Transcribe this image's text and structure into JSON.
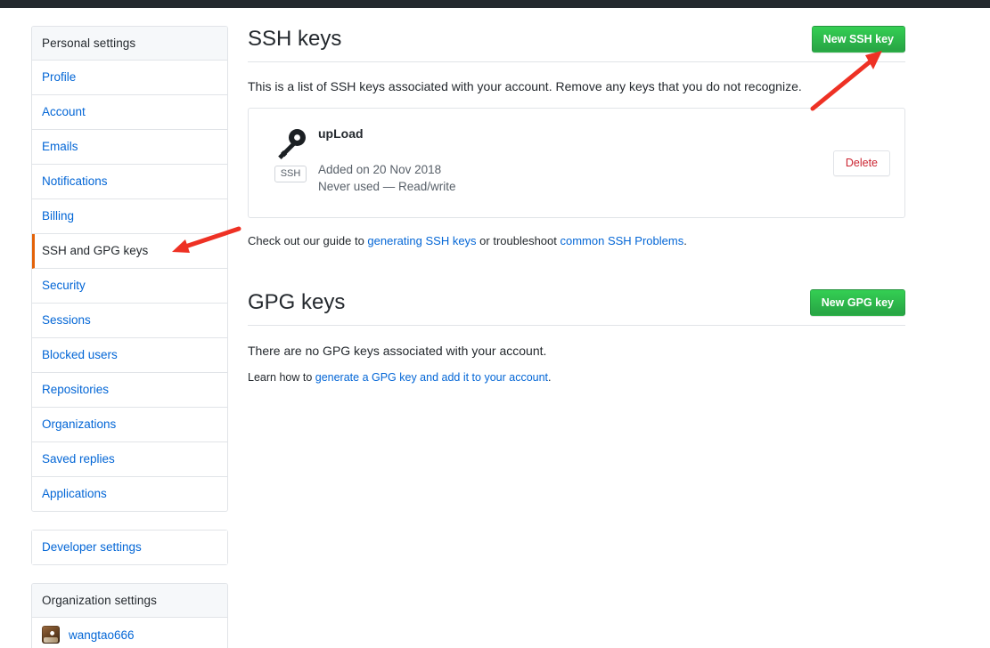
{
  "sidebar": {
    "personal": {
      "header": "Personal settings",
      "items": [
        {
          "label": "Profile",
          "selected": false
        },
        {
          "label": "Account",
          "selected": false
        },
        {
          "label": "Emails",
          "selected": false
        },
        {
          "label": "Notifications",
          "selected": false
        },
        {
          "label": "Billing",
          "selected": false
        },
        {
          "label": "SSH and GPG keys",
          "selected": true
        },
        {
          "label": "Security",
          "selected": false
        },
        {
          "label": "Sessions",
          "selected": false
        },
        {
          "label": "Blocked users",
          "selected": false
        },
        {
          "label": "Repositories",
          "selected": false
        },
        {
          "label": "Organizations",
          "selected": false
        },
        {
          "label": "Saved replies",
          "selected": false
        },
        {
          "label": "Applications",
          "selected": false
        }
      ]
    },
    "developer": {
      "label": "Developer settings"
    },
    "organization": {
      "header": "Organization settings",
      "items": [
        {
          "label": "wangtao666"
        }
      ]
    }
  },
  "ssh_section": {
    "title": "SSH keys",
    "new_button": "New SSH key",
    "description": "This is a list of SSH keys associated with your account. Remove any keys that you do not recognize.",
    "keys": [
      {
        "badge": "SSH",
        "title": "upLoad",
        "added": "Added on 20 Nov 2018",
        "usage": "Never used — Read/write",
        "delete_label": "Delete"
      }
    ],
    "help_prefix": "Check out our guide to ",
    "help_link1": "generating SSH keys",
    "help_middle": " or troubleshoot ",
    "help_link2": "common SSH Problems",
    "help_suffix": "."
  },
  "gpg_section": {
    "title": "GPG keys",
    "new_button": "New GPG key",
    "empty_text": "There are no GPG keys associated with your account.",
    "learn_prefix": "Learn how to ",
    "learn_link": "generate a GPG key and add it to your account",
    "learn_suffix": "."
  },
  "annotations": {
    "color": "#ee3124",
    "arrow_to_new_ssh_key": "arrow pointing up-right to New SSH key button",
    "arrow_to_ssh_gpg_nav": "arrow pointing down-left to SSH and GPG keys nav item"
  },
  "colors": {
    "topbar": "#24292e",
    "green_button": "#28a745",
    "link": "#0366d6",
    "selected_border": "#e36209",
    "delete_text": "#cb2431",
    "border": "#e1e4e8"
  }
}
